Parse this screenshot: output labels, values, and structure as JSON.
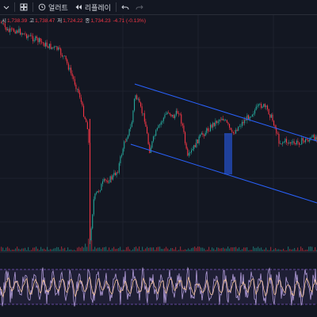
{
  "toolbar": {
    "alerts_label": "얼러트",
    "replay_label": "리플레이",
    "icons": [
      "chevron-down-icon",
      "grid-icon",
      "alert-clock-icon",
      "replay-icon",
      "undo-icon",
      "redo-icon"
    ]
  },
  "ohlc": {
    "open_key": "시",
    "open_value": "1,738.39",
    "high_key": "고",
    "high_value": "1,738.47",
    "low_key": "저",
    "low_value": "1,724.22",
    "close_key": "종",
    "close_value": "1,734.23",
    "change": "-4.71 (-0.13%)"
  },
  "colors": {
    "background": "#131722",
    "up": "#26a69a",
    "down": "#f23645",
    "channel": "#2962ff",
    "highlight": "#2962ff",
    "oscillator_main": "#b39ddb",
    "oscillator_signal": "#f7c59f",
    "oscillator_band": "#7e57c2",
    "grid": "#1e222d"
  },
  "chart_data": {
    "type": "candlestick",
    "title": "",
    "xlabel": "",
    "ylabel": "",
    "trend": "sharp decline, capitulation spike, recovery, then descending channel",
    "channel": "descending parallel channel drawn over recovery phase",
    "oscillator": "bounded oscillator with dashed upper/lower bands",
    "grid": true
  }
}
